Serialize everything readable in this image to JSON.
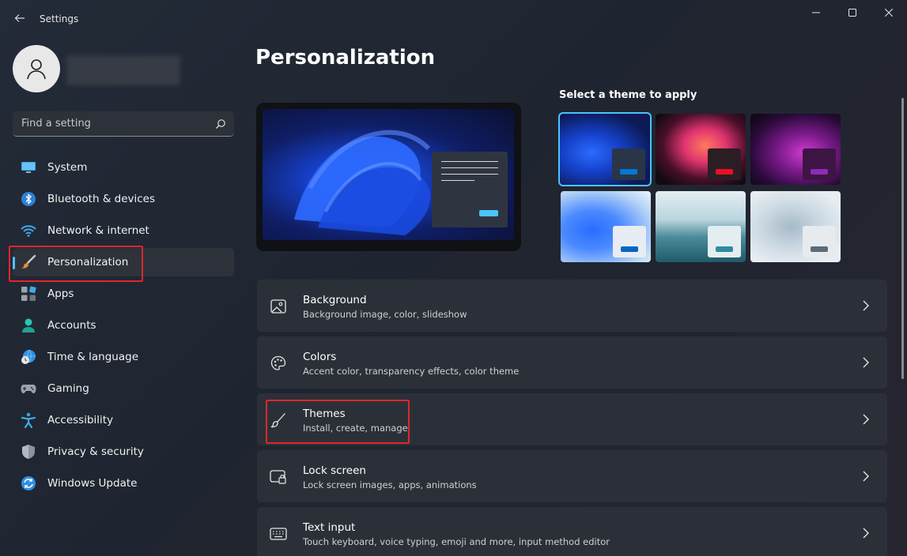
{
  "window": {
    "title": "Settings",
    "controls": [
      "minimize",
      "maximize",
      "close"
    ]
  },
  "search": {
    "placeholder": "Find a setting"
  },
  "sidebar": {
    "items": [
      {
        "label": "System",
        "icon": "monitor-icon",
        "active": false
      },
      {
        "label": "Bluetooth & devices",
        "icon": "bluetooth-icon",
        "active": false
      },
      {
        "label": "Network & internet",
        "icon": "wifi-icon",
        "active": false
      },
      {
        "label": "Personalization",
        "icon": "paintbrush-icon",
        "active": true
      },
      {
        "label": "Apps",
        "icon": "apps-icon",
        "active": false
      },
      {
        "label": "Accounts",
        "icon": "person-icon",
        "active": false
      },
      {
        "label": "Time & language",
        "icon": "globe-clock-icon",
        "active": false
      },
      {
        "label": "Gaming",
        "icon": "gamepad-icon",
        "active": false
      },
      {
        "label": "Accessibility",
        "icon": "accessibility-icon",
        "active": false
      },
      {
        "label": "Privacy & security",
        "icon": "shield-icon",
        "active": false
      },
      {
        "label": "Windows Update",
        "icon": "update-icon",
        "active": false
      }
    ]
  },
  "main": {
    "title": "Personalization",
    "theme_heading": "Select a theme to apply",
    "themes": [
      {
        "name": "windows-dark",
        "accent": "#0078d4",
        "selected": true
      },
      {
        "name": "glow",
        "accent": "#e81123",
        "selected": false
      },
      {
        "name": "captured-motion",
        "accent": "#8e2bb5",
        "selected": false
      },
      {
        "name": "windows-light",
        "accent": "#0067c0",
        "selected": false
      },
      {
        "name": "sunrise-lake",
        "accent": "#2e8ba3",
        "selected": false
      },
      {
        "name": "flow",
        "accent": "#5b6b78",
        "selected": false
      }
    ],
    "cards": [
      {
        "title": "Background",
        "subtitle": "Background image, color, slideshow",
        "icon": "image-icon"
      },
      {
        "title": "Colors",
        "subtitle": "Accent color, transparency effects, color theme",
        "icon": "palette-icon"
      },
      {
        "title": "Themes",
        "subtitle": "Install, create, manage",
        "icon": "brush-icon"
      },
      {
        "title": "Lock screen",
        "subtitle": "Lock screen images, apps, animations",
        "icon": "lock-screen-icon"
      },
      {
        "title": "Text input",
        "subtitle": "Touch keyboard, voice typing, emoji and more, input method editor",
        "icon": "keyboard-icon"
      }
    ]
  },
  "colors": {
    "accent": "#4cc2ff",
    "highlight": "#e0262b"
  }
}
